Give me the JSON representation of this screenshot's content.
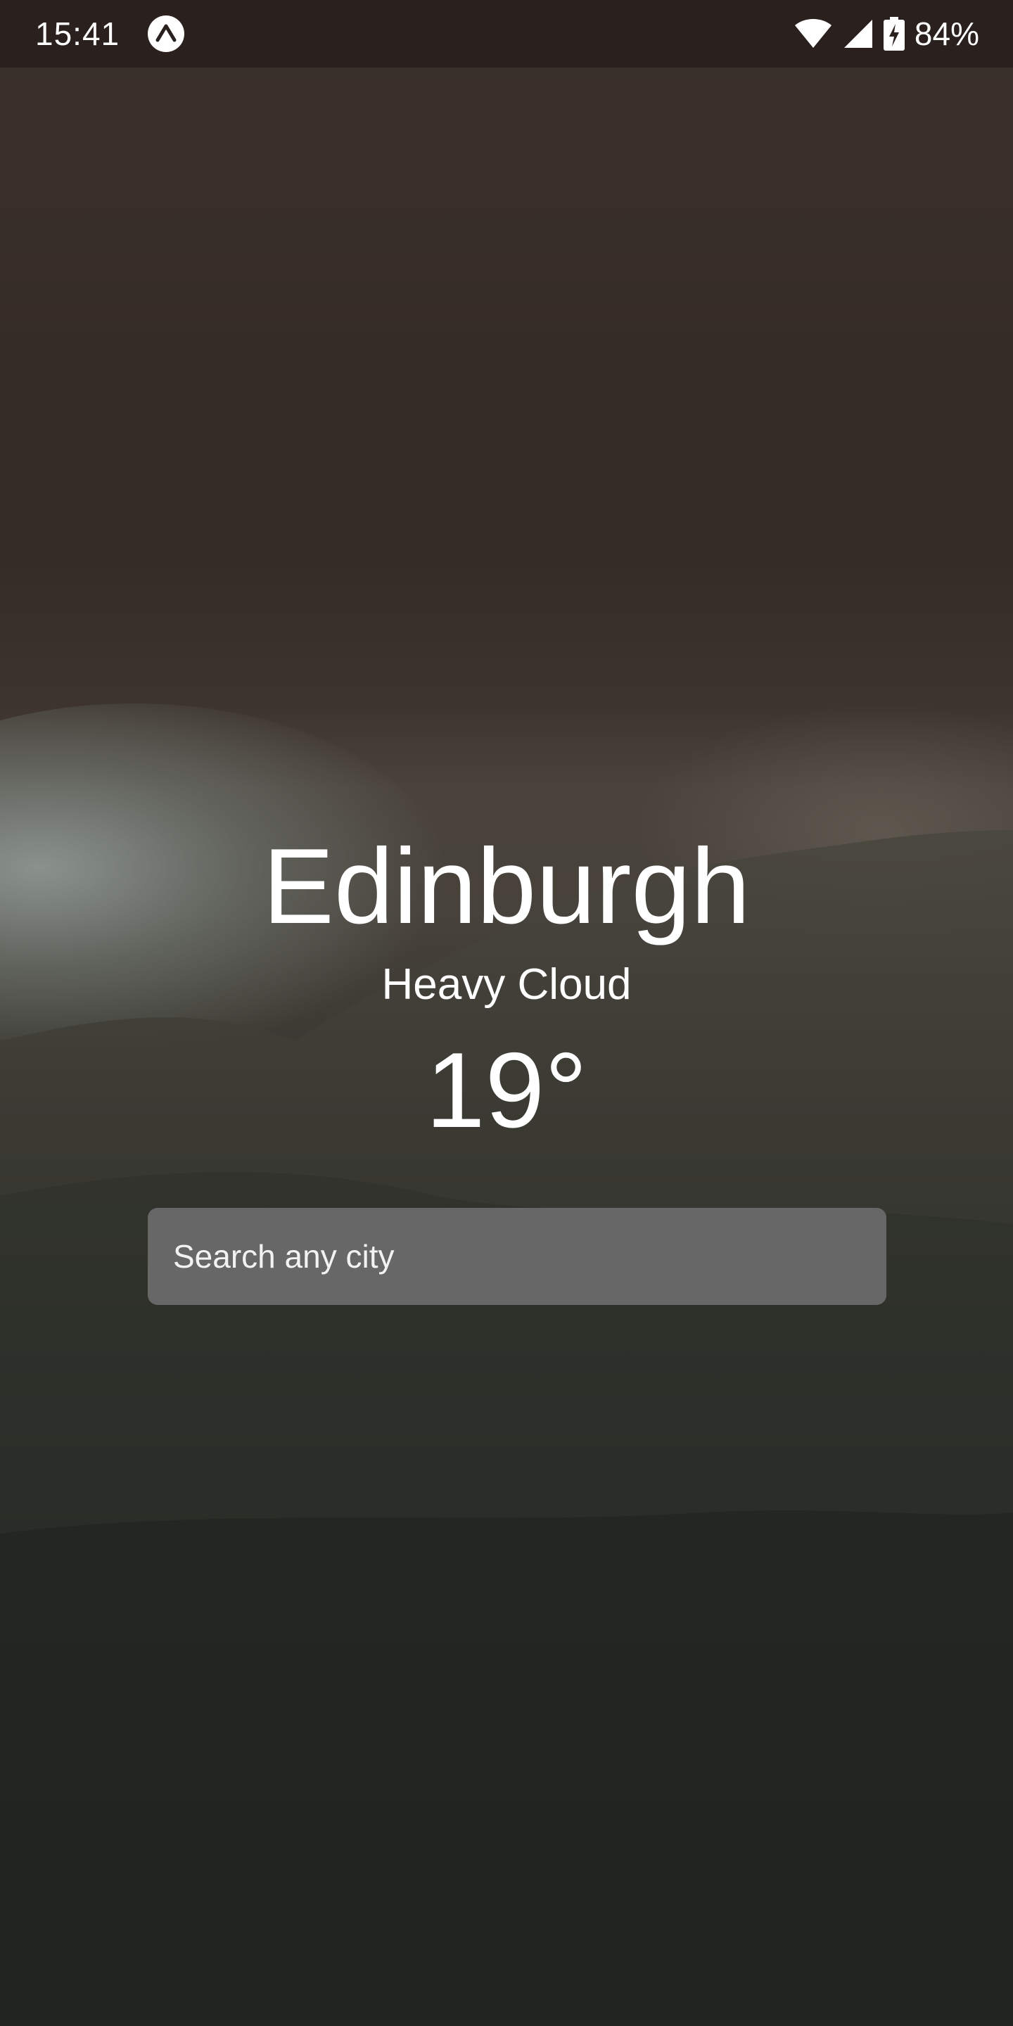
{
  "status_bar": {
    "time": "15:41",
    "app_icon": "expo-app-icon",
    "wifi_icon": "wifi-icon",
    "signal_icon": "cell-signal-icon",
    "battery_icon": "battery-charging-icon",
    "battery_percent": "84%"
  },
  "weather": {
    "city": "Edinburgh",
    "condition": "Heavy Cloud",
    "temperature": "19°"
  },
  "search": {
    "placeholder": "Search any city",
    "value": ""
  },
  "colors": {
    "status_bar_bg": "#2a201d",
    "search_bg": "#676767",
    "text": "#ffffff"
  }
}
